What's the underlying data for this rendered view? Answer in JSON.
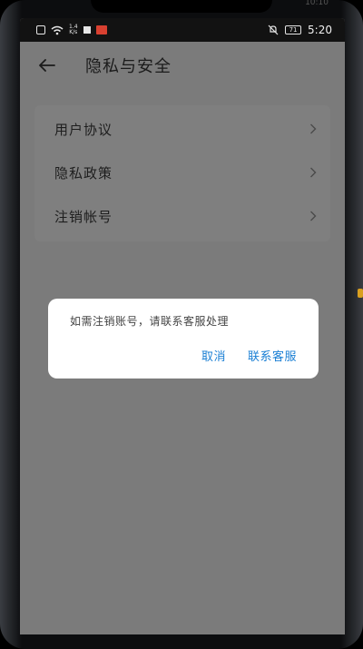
{
  "status_bar": {
    "net_speed_top": "1.4",
    "net_speed_bottom": "K/s",
    "battery": "71",
    "time": "5:20",
    "top_time": "10:10"
  },
  "header": {
    "title": "隐私与安全"
  },
  "menu": {
    "items": [
      {
        "label": "用户协议"
      },
      {
        "label": "隐私政策"
      },
      {
        "label": "注销帐号"
      }
    ]
  },
  "dialog": {
    "message": "如需注销账号，请联系客服处理",
    "cancel_label": "取消",
    "contact_label": "联系客服"
  },
  "colors": {
    "dialog_button": "#1a7fd4",
    "overlay_background": "#7b7b7b"
  }
}
